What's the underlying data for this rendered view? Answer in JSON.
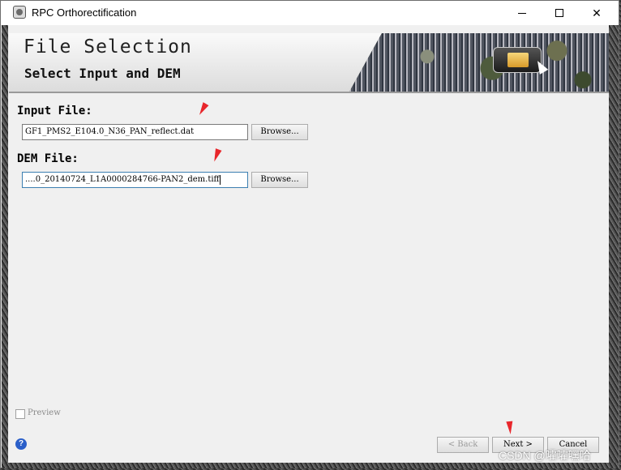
{
  "window": {
    "title": "RPC Orthorectification",
    "controls": {
      "minimize": "",
      "maximize": "",
      "close": "✕"
    }
  },
  "header": {
    "title": "File Selection",
    "subtitle": "Select Input and DEM",
    "icon": "open-folder-icon"
  },
  "input_file": {
    "label": "Input File:",
    "value": "GF1_PMS2_E104.0_N36_PAN_reflect.dat",
    "browse_label": "Browse..."
  },
  "dem_file": {
    "label": "DEM File:",
    "value": "....0_20140724_L1A0000284766-PAN2_dem.tiff",
    "browse_label": "Browse..."
  },
  "preview": {
    "label": "Preview",
    "checked": false
  },
  "footer": {
    "back_label": "< Back",
    "next_label": "Next >",
    "cancel_label": "Cancel",
    "help_icon": "help-icon"
  },
  "watermark": "CSDN @嚯嚯嘿哈",
  "colors": {
    "annotation_arrow": "#e8262b",
    "focus_border": "#3c7fb1"
  }
}
